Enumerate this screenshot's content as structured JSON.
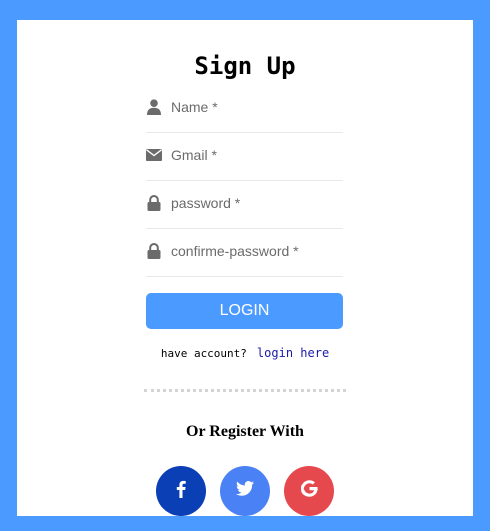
{
  "form": {
    "title": "Sign Up",
    "fields": [
      {
        "placeholder": "Name *",
        "icon": "user-icon"
      },
      {
        "placeholder": "Gmail *",
        "icon": "envelope-icon"
      },
      {
        "placeholder": "password *",
        "icon": "lock-icon"
      },
      {
        "placeholder": "confirme-password *",
        "icon": "lock-icon"
      }
    ],
    "submit_label": "LOGIN",
    "account_prompt": "have account?",
    "account_link": "login here",
    "or_text": "Or Register With"
  },
  "social": [
    {
      "name": "facebook",
      "icon": "facebook-icon",
      "color": "#0a3fb5"
    },
    {
      "name": "twitter",
      "icon": "twitter-icon",
      "color": "#4a82f5"
    },
    {
      "name": "google",
      "icon": "google-icon",
      "color": "#e5484d"
    }
  ],
  "colors": {
    "background": "#4a9aff",
    "card": "#ffffff",
    "button": "#4a9aff",
    "link": "#1a1aa6",
    "icon": "#6b6b6b"
  }
}
